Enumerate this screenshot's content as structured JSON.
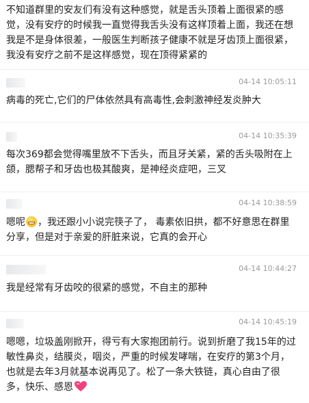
{
  "comments": [
    {
      "timestamp": "",
      "text": "不知道群里的安友们有没有这种感觉，就是舌头顶着上面很紧的感觉，没有安疗的时候我一直觉得我舌头没有这样顶着上面，我还在想我是不是身体很差，一般医生判断孩子健康不就是牙齿顶上面很紧，我没有安疗之前不是这样感觉，现在顶得紧紧的"
    },
    {
      "timestamp": "04-14 10:05:11",
      "text": "病毒的死亡,它们的尸体依然具有高毒性,会刺激神经发炎肿大"
    },
    {
      "timestamp": "04-14 10:35:39",
      "text": "每次369都会觉得嘴里放不下舌头，而且牙关紧，紧的舌头吸附在上颌，腮帮子和牙齿也极其酸爽，是神经炎症吧，三叉"
    },
    {
      "timestamp": "04-14 10:38:59",
      "text_before_emoji": "嗯呢",
      "text_after_emoji": "，我还跟小小说完筷子了， 毒素依旧拱，都不好意思在群里分享，但是对于亲爱的肝脏来说，它真的会开心",
      "emoji": "grinning-face-icon"
    },
    {
      "timestamp": "04-14 10:44:27",
      "text": "我是经常有牙齿咬的很紧的感觉，不自主的那种"
    },
    {
      "timestamp": "04-14 10:45:19",
      "text": "嗯嗯，垃圾盖刚掀开，得亏有大家抱团前行。说到折磨了我15年的过敏性鼻炎，结膜炎，咽炎，严重的时候发哮喘，在安疗的第3个月，也就是去年3月就基本说再见了。松了一条大铁链，真心自由了很多，快乐、感恩",
      "emoji": "pink-heart-icon"
    }
  ],
  "colors": {
    "text": "#222222",
    "timestamp": "#9a9a9a",
    "separator": "#eeeeee",
    "heart": "#f0427a"
  }
}
